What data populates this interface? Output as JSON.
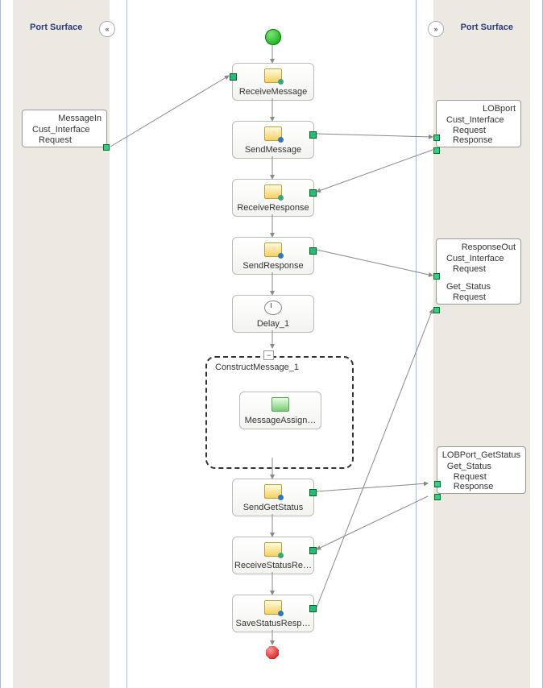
{
  "chart_data": {
    "type": "orchestration-flow",
    "start": "Start",
    "end": "End",
    "shapes": [
      {
        "id": "ReceiveMessage",
        "label": "ReceiveMessage",
        "kind": "receive"
      },
      {
        "id": "SendMessage",
        "label": "SendMessage",
        "kind": "send"
      },
      {
        "id": "ReceiveResponse",
        "label": "ReceiveResponse",
        "kind": "receive"
      },
      {
        "id": "SendResponse",
        "label": "SendResponse",
        "kind": "send"
      },
      {
        "id": "Delay_1",
        "label": "Delay_1",
        "kind": "delay"
      },
      {
        "id": "ConstructMessage_1",
        "label": "ConstructMessage_1",
        "kind": "construct",
        "children": [
          {
            "id": "MessageAssign",
            "label": "MessageAssign…",
            "kind": "assign"
          }
        ]
      },
      {
        "id": "SendGetStatus",
        "label": "SendGetStatus",
        "kind": "send"
      },
      {
        "id": "ReceiveStatusRe",
        "label": "ReceiveStatusRe…",
        "kind": "receive"
      },
      {
        "id": "SaveStatusResp",
        "label": "SaveStatusResp…",
        "kind": "send"
      }
    ],
    "links": [
      {
        "from": "MessageIn.Cust_Interface.Request",
        "to": "ReceiveMessage"
      },
      {
        "from": "SendMessage",
        "to": "LOBport.Cust_Interface.Request"
      },
      {
        "from": "LOBport.Cust_Interface.Response",
        "to": "ReceiveResponse"
      },
      {
        "from": "SendResponse",
        "to": "ResponseOut.Cust_Interface.Request"
      },
      {
        "from": "SendGetStatus",
        "to": "LOBPort_GetStatus.Get_Status.Request"
      },
      {
        "from": "LOBPort_GetStatus.Get_Status.Response",
        "to": "ReceiveStatusRe"
      },
      {
        "from": "SaveStatusResp",
        "to": "ResponseOut.Get_Status.Request"
      }
    ]
  },
  "left_header": "Port Surface",
  "right_header": "Port Surface",
  "collapse_left": "«",
  "collapse_right": "»",
  "scope_toggle": "−",
  "ports": {
    "MessageIn": {
      "title": "MessageIn",
      "op": "Cust_Interface",
      "io": [
        "Request"
      ]
    },
    "LOBport": {
      "title": "LOBport",
      "op": "Cust_Interface",
      "io": [
        "Request",
        "Response"
      ]
    },
    "ResponseOut": {
      "title": "ResponseOut",
      "ops": [
        {
          "op": "Cust_Interface",
          "io": [
            "Request"
          ]
        },
        {
          "op": "Get_Status",
          "io": [
            "Request"
          ]
        }
      ]
    },
    "LOBPort_GetStatus": {
      "title": "LOBPort_GetStatus",
      "op": "Get_Status",
      "io": [
        "Request",
        "Response"
      ]
    }
  },
  "shapes": {
    "ReceiveMessage": "ReceiveMessage",
    "SendMessage": "SendMessage",
    "ReceiveResponse": "ReceiveResponse",
    "SendResponse": "SendResponse",
    "Delay_1": "Delay_1",
    "ConstructMessage_1": "ConstructMessage_1",
    "MessageAssign": "MessageAssign…",
    "SendGetStatus": "SendGetStatus",
    "ReceiveStatusRe": "ReceiveStatusRe…",
    "SaveStatusResp": "SaveStatusResp…"
  }
}
